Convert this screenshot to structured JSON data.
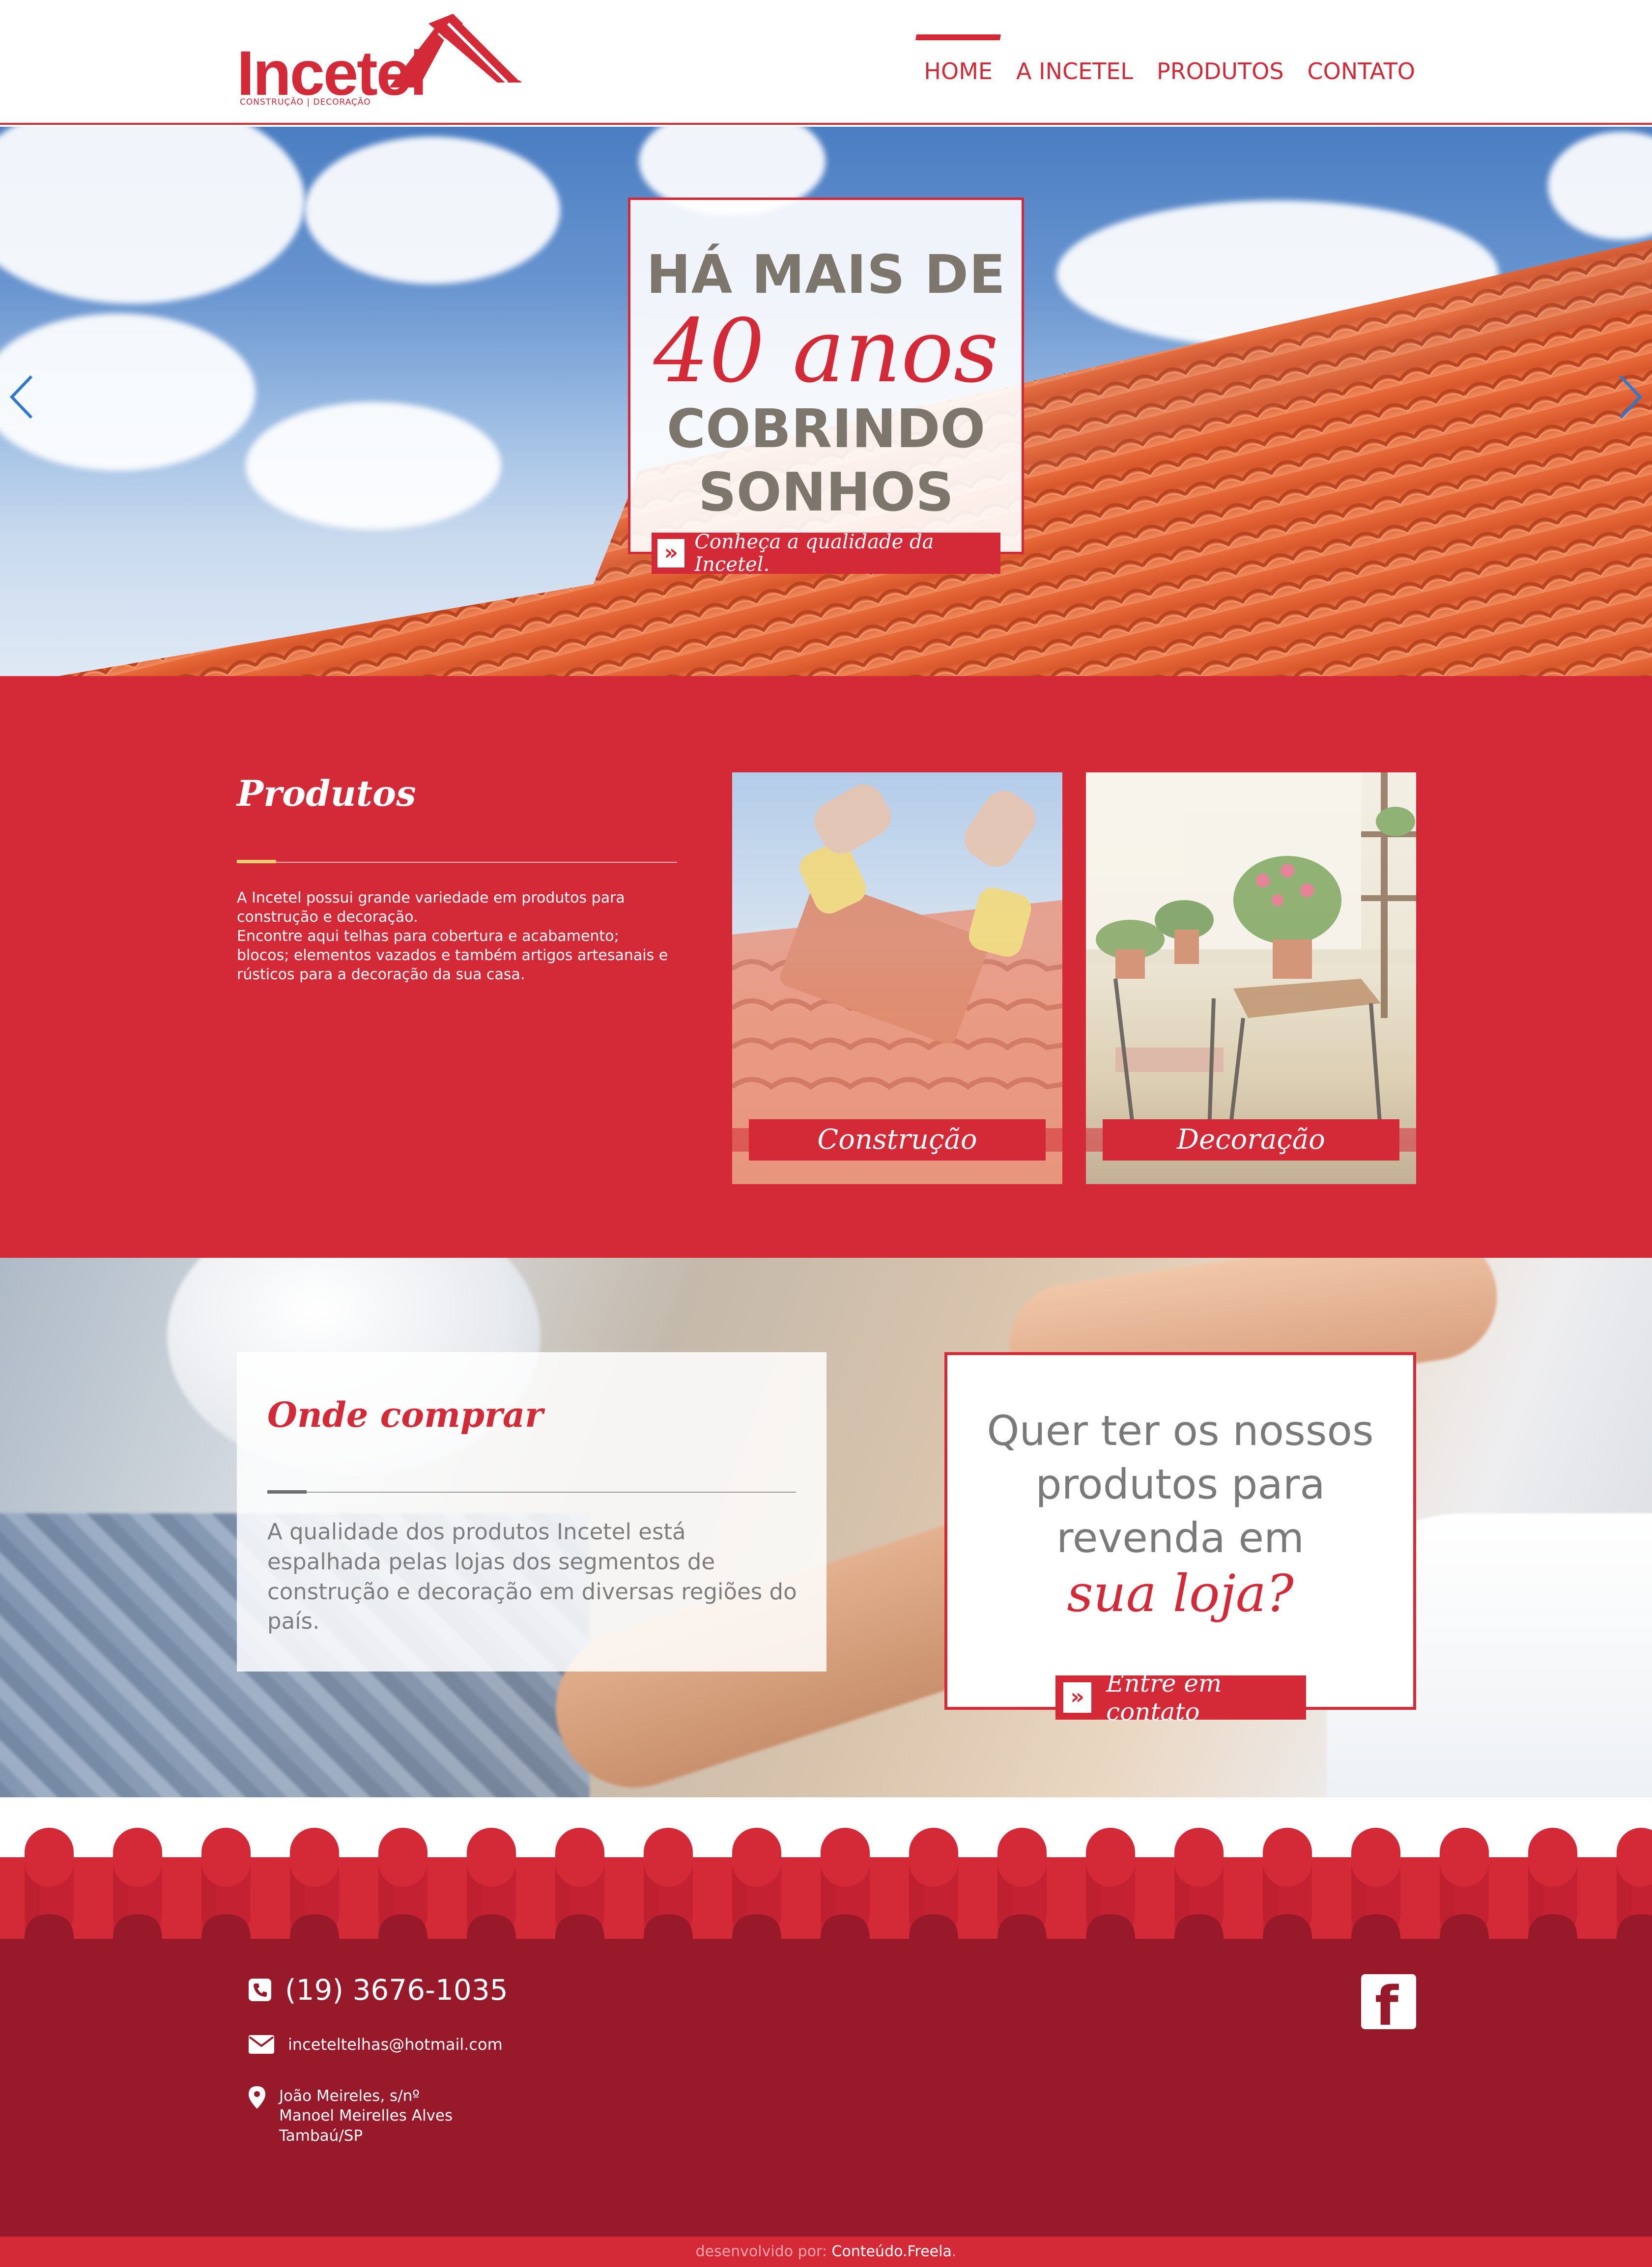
{
  "brand": {
    "name": "Incetel",
    "tagline": "CONSTRUÇÃO | DECORAÇÃO",
    "color": "#d42a37"
  },
  "nav": {
    "items": [
      {
        "label": "HOME",
        "active": true
      },
      {
        "label": "A INCETEL",
        "active": false
      },
      {
        "label": "PRODUTOS",
        "active": false
      },
      {
        "label": "CONTATO",
        "active": false
      }
    ]
  },
  "hero": {
    "line1": "HÁ MAIS DE",
    "line2": "40 anos",
    "line3a": "COBRINDO",
    "line3b": "SONHOS",
    "cta_label": "Conheça a qualidade da Incetel.",
    "cta_icon": "double-chevron-right-icon",
    "slides_total": 3,
    "slide_active": 1
  },
  "produtos": {
    "title": "Produtos",
    "paragraph1": "A Incetel possui grande variedade em produtos para construção e decoração.",
    "paragraph2": "Encontre aqui telhas para cobertura e acabamento; blocos; elementos vazados e também artigos artesanais e rústicos para a decoração da sua casa.",
    "cards": [
      {
        "label": "Construção"
      },
      {
        "label": "Decoração"
      }
    ]
  },
  "onde": {
    "title": "Onde comprar",
    "text": "A qualidade dos produtos Incetel está espalhada pelas lojas dos segmentos de construção e decoração em diversas regiões do país."
  },
  "revenda": {
    "line1": "Quer ter os nossos",
    "line2": "produtos para",
    "line3": "revenda em",
    "accent": "sua loja?",
    "cta_label": "Entre em contato",
    "cta_icon": "double-chevron-right-icon"
  },
  "footer": {
    "phone": "(19) 3676-1035",
    "email": "inceteltelhas@hotmail.com",
    "address": [
      "João Meireles, s/nº",
      "Manoel Meirelles Alves",
      "Tambaú/SP"
    ],
    "social": "facebook-icon",
    "credits_prefix": "desenvolvido por:",
    "credits_name": "Conteúdo.Freela",
    "credits_suffix": "."
  }
}
